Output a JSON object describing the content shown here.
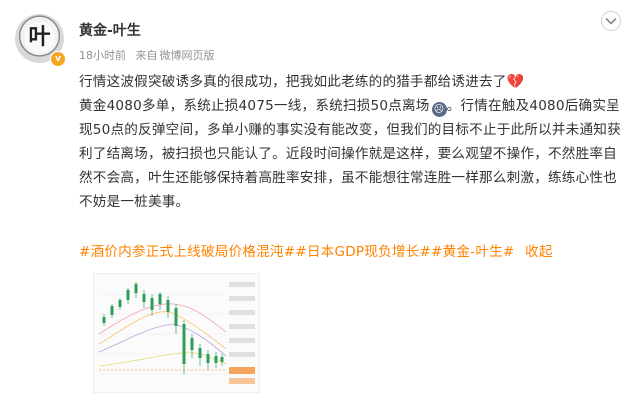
{
  "post": {
    "author": "黄金-叶生",
    "avatar_glyph": "叶",
    "verified_badge": "v",
    "time": "18小时前",
    "source_prefix": "来自",
    "source": "微博网页版",
    "paragraph": {
      "line1": "行情这波假突破诱多真的很成功，把我如此老练的的猎手都给诱进去了",
      "heart_emoji": "💔",
      "line2a": "黄金4080多单，系统止损4075一线，系统扫损50点离场",
      "face_emoji": "☹",
      "line2b": "。行情在触及4080后确实呈现50点的反弹空间，多单小赚的事实没有能改变，但我们的目标不止于此所以并未通知获利了结离场，被扫损也只能认了。近段时间操作就是这样，要么观望不操作，不然胜率自然不会高，叶生还能够保持着高胜率安排，虽不能想往常连胜一样那么刺激，练练心性也不妨是一桩美事。"
    },
    "tags": [
      "#酒价内参正式上线破局价格混沌#",
      "#日本GDP现负增长#",
      "#黄金-叶生#"
    ],
    "collapse_label": "收起"
  },
  "colors": {
    "tag": "#ff8200",
    "badge": "#f5a623",
    "meta": "#939393"
  }
}
